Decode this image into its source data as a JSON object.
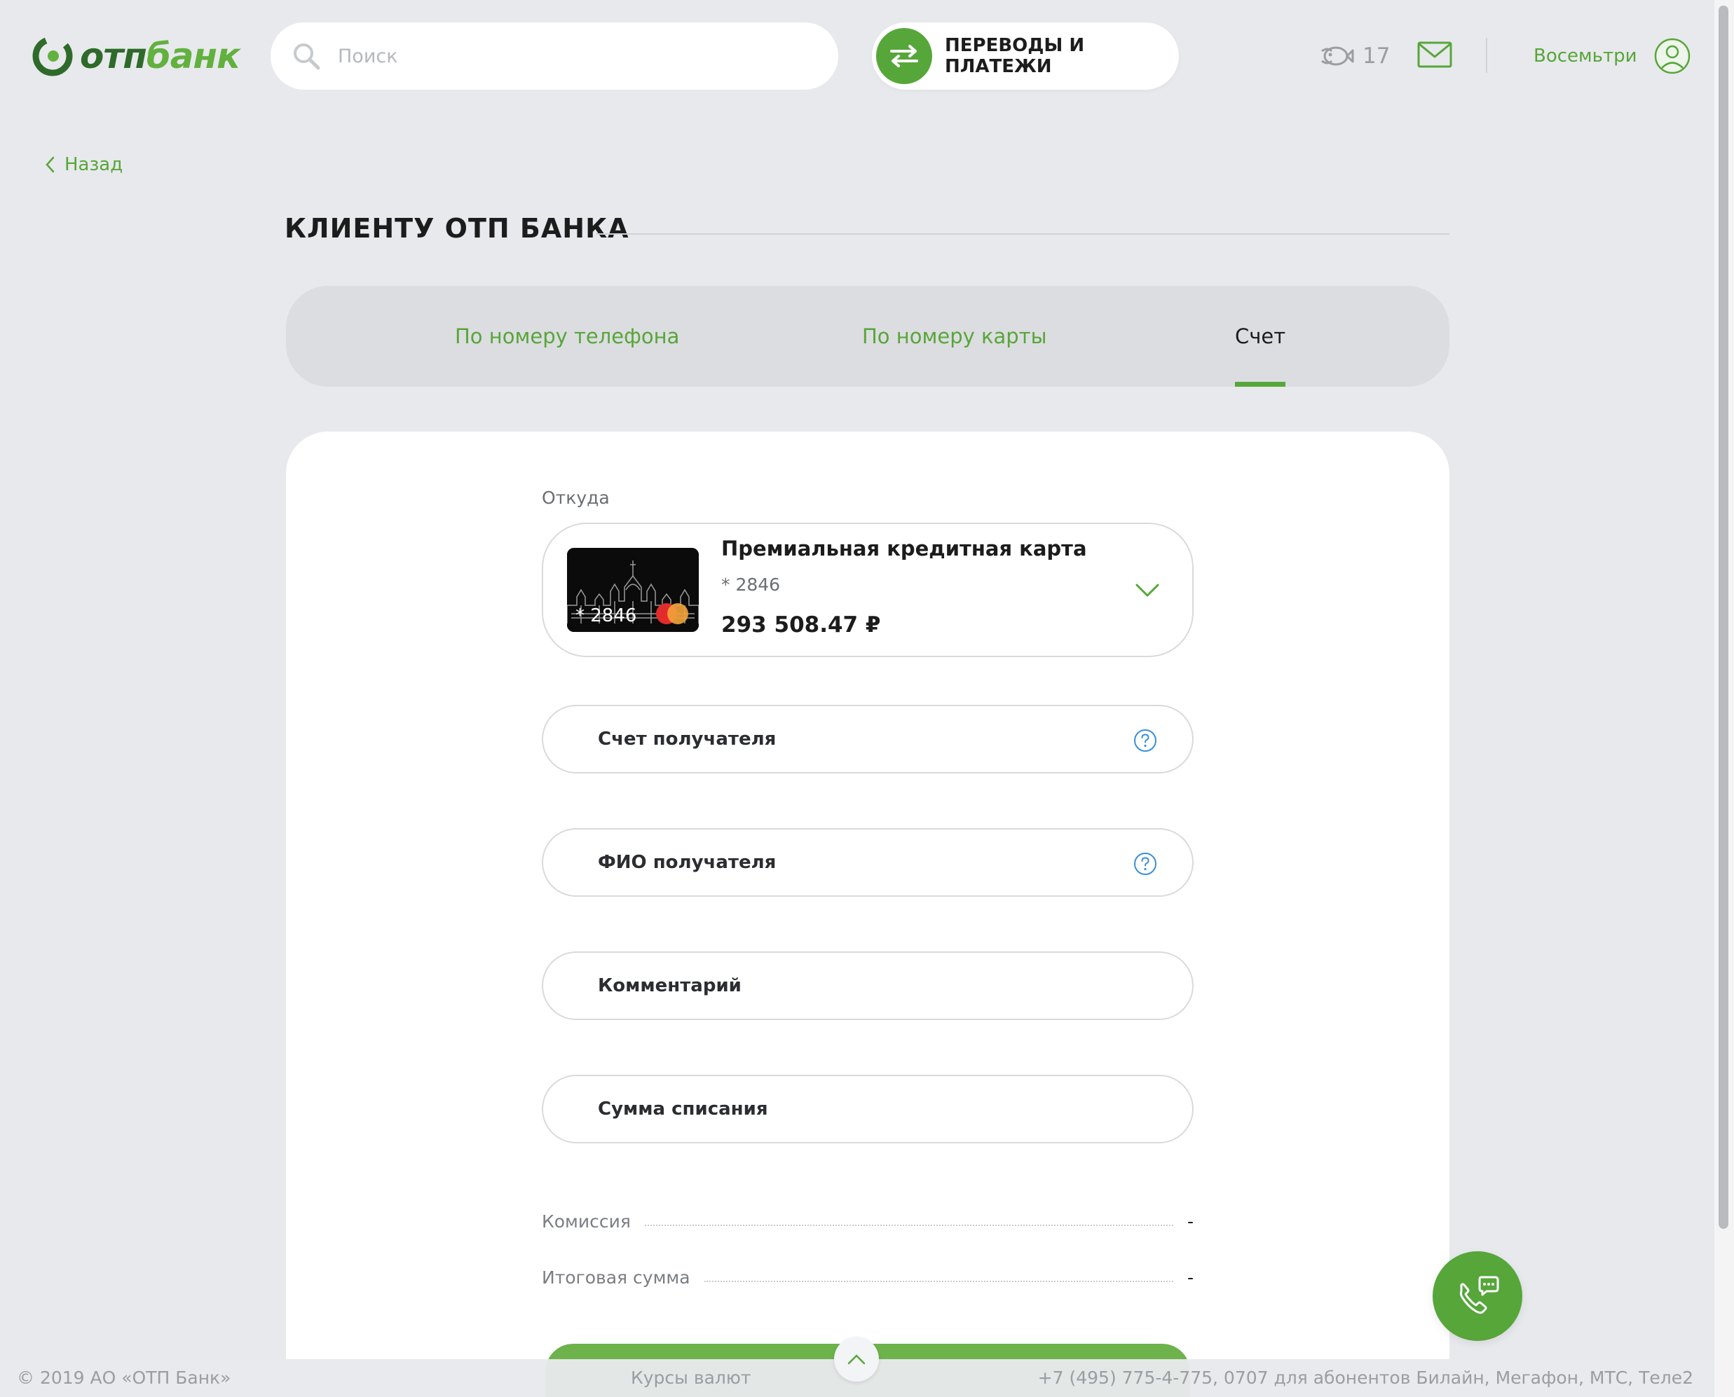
{
  "header": {
    "logo_otp": "отп",
    "logo_bank": "банк",
    "search_placeholder": "Поиск",
    "transfers_label": "ПЕРЕВОДЫ И ПЛАТЕЖИ",
    "bonus_count": "17",
    "user_name": "Восемьтри"
  },
  "nav": {
    "back_label": "Назад"
  },
  "page": {
    "title": "КЛИЕНТУ ОТП БАНКА"
  },
  "tabs": [
    {
      "label": "По номеру телефона",
      "active": false
    },
    {
      "label": "По номеру карты",
      "active": false
    },
    {
      "label": "Счет",
      "active": true
    }
  ],
  "form": {
    "from_label": "Откуда",
    "card": {
      "name": "Премиальная кредитная карта",
      "number": "* 2846",
      "thumb_number": "* 2846",
      "balance": "293 508.47 ₽"
    },
    "fields": {
      "recipient_account": "Счет получателя",
      "recipient_name": "ФИО получателя",
      "comment": "Комментарий",
      "amount": "Сумма списания"
    },
    "summary": {
      "commission_label": "Комиссия",
      "commission_value": "-",
      "total_label": "Итоговая сумма",
      "total_value": "-"
    }
  },
  "footer": {
    "copyright": "© 2019 АО «ОТП Банк»",
    "rates_link": "Курсы валют",
    "phones": "+7 (495) 775-4-775,  0707 для абонентов Билайн, Мегафон, МТС, Теле2"
  },
  "colors": {
    "accent_green": "#57a63a",
    "dark_green": "#2e6b2a",
    "background": "#e8e9ec"
  }
}
